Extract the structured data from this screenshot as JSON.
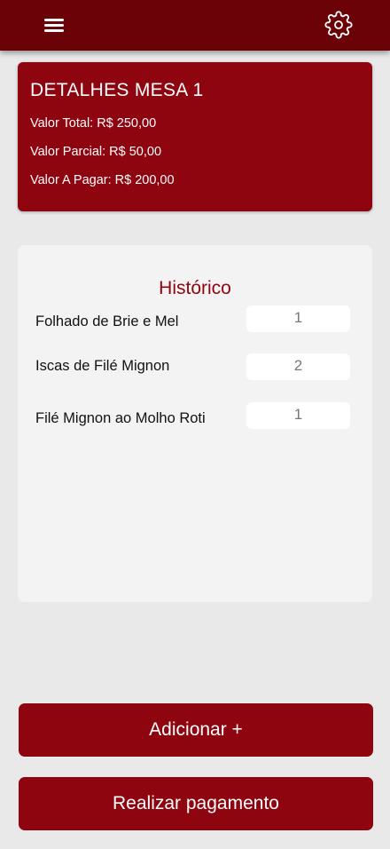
{
  "header": {
    "menu_icon": "hamburger-menu-icon",
    "settings_icon": "gear-icon"
  },
  "details": {
    "title": "DETALHES MESA 1",
    "valor_total": "Valor Total: R$ 250,00",
    "valor_parcial": "Valor Parcial: R$ 50,00",
    "valor_a_pagar": "Valor A Pagar: R$ 200,00"
  },
  "history": {
    "title": "Histórico",
    "items": [
      {
        "name": "Folhado de Brie e Mel",
        "qty": "1"
      },
      {
        "name": "Iscas de Filé Mignon",
        "qty": "2"
      },
      {
        "name": "Filé Mignon ao Molho Roti",
        "qty": "1"
      }
    ]
  },
  "actions": {
    "add_label": "Adicionar +",
    "pay_label": "Realizar pagamento"
  },
  "colors": {
    "header_bg": "#6b0208",
    "accent": "#8e0510",
    "page_bg": "#e9e9e9",
    "card_bg": "#f3f3f3"
  }
}
